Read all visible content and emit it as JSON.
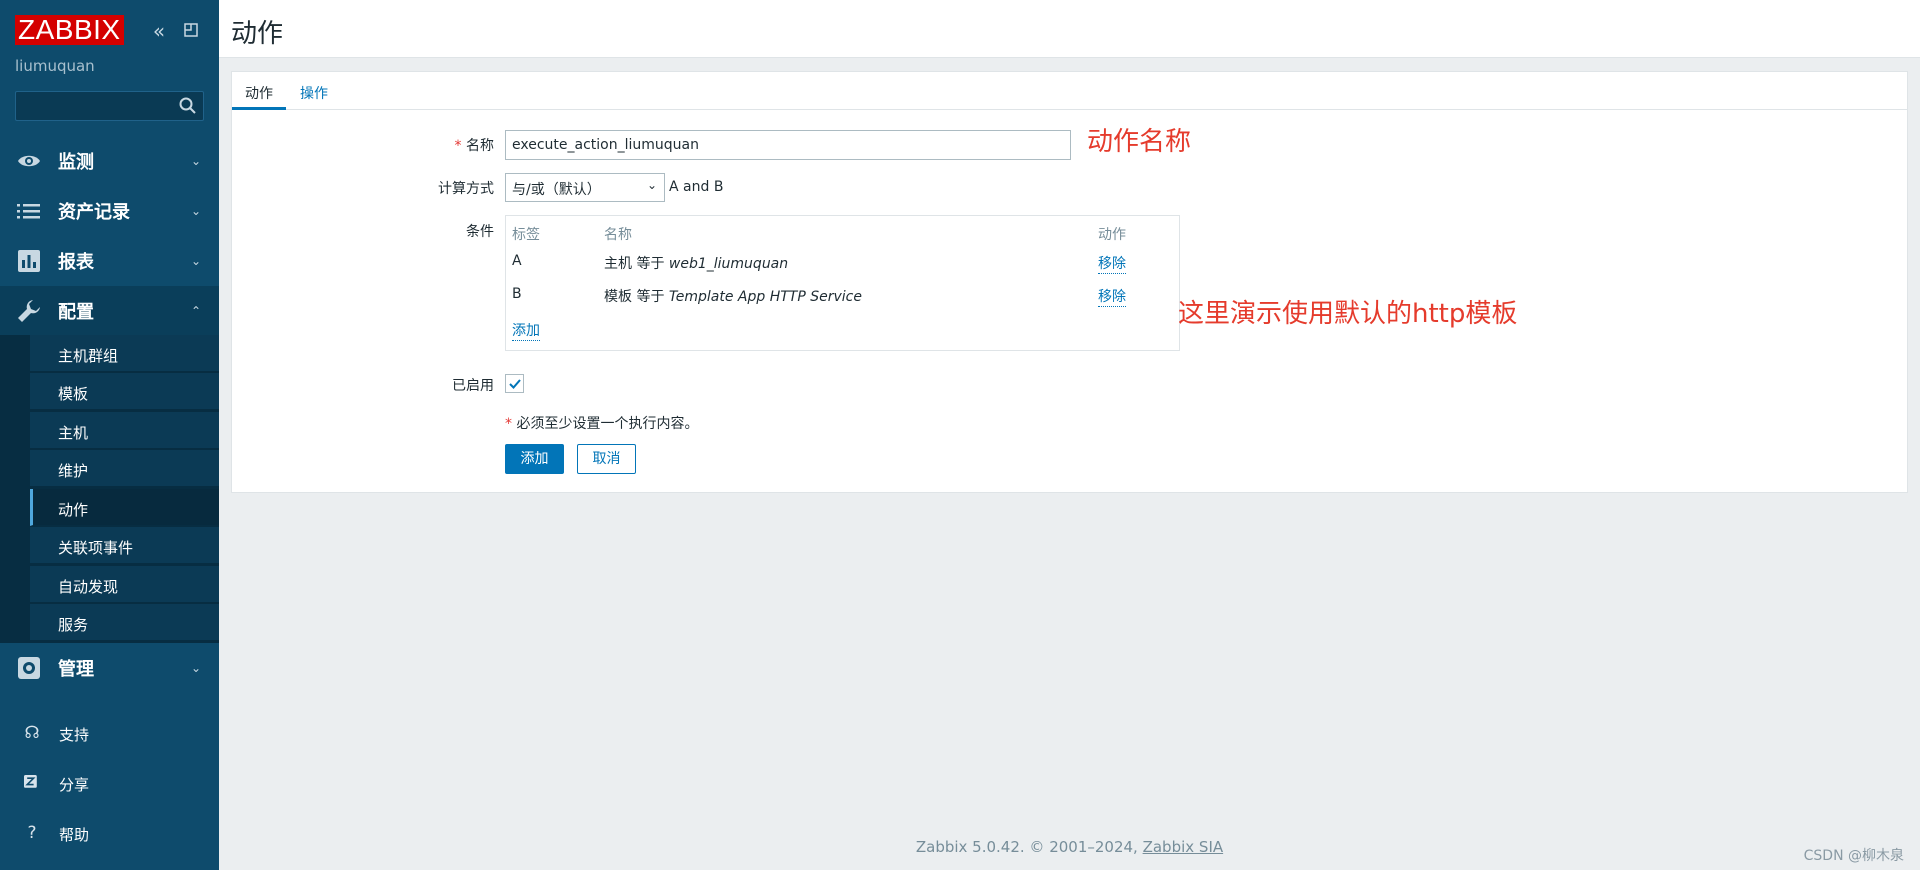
{
  "sidebar": {
    "logo": "ZABBIX",
    "username": "liumuquan",
    "search_placeholder": "",
    "menu": [
      {
        "label": "监测",
        "icon": "eye-icon"
      },
      {
        "label": "资产记录",
        "icon": "list-icon"
      },
      {
        "label": "报表",
        "icon": "bar-chart-icon"
      },
      {
        "label": "配置",
        "icon": "wrench-icon"
      },
      {
        "label": "管理",
        "icon": "gear-icon"
      }
    ],
    "config_submenu": [
      "主机群组",
      "模板",
      "主机",
      "维护",
      "动作",
      "关联项事件",
      "自动发现",
      "服务"
    ],
    "bottom": [
      {
        "label": "支持",
        "icon": "headset-icon"
      },
      {
        "label": "分享",
        "icon": "share-icon"
      },
      {
        "label": "帮助",
        "icon": "help-icon"
      }
    ]
  },
  "header": {
    "title": "动作"
  },
  "tabs": [
    "动作",
    "操作"
  ],
  "form": {
    "name_label": "名称",
    "name_value": "execute_action_liumuquan",
    "calc_label": "计算方式",
    "calc_value": "与/或（默认）",
    "calc_formula": "A and B",
    "conditions_label": "条件",
    "conditions_headers": {
      "tag": "标签",
      "name": "名称",
      "action": "动作"
    },
    "conditions": [
      {
        "tag": "A",
        "prefix": "主机 等于 ",
        "value": "web1_liumuquan",
        "action": "移除"
      },
      {
        "tag": "B",
        "prefix": "模板 等于 ",
        "value": "Template App HTTP Service",
        "action": "移除"
      }
    ],
    "add_condition": "添加",
    "enabled_label": "已启用",
    "enabled": true,
    "note": "必须至少设置一个执行内容。",
    "add_button": "添加",
    "cancel_button": "取消"
  },
  "annotations": {
    "name_note": "动作名称",
    "template_note": "这里演示使用默认的http模板"
  },
  "footer": {
    "text": "Zabbix 5.0.42. © 2001–2024,",
    "link": "Zabbix SIA"
  },
  "watermark": "CSDN @柳木泉",
  "colors": {
    "sidebar": "#0e4b6c",
    "accent": "#0275b8",
    "logo": "#d40000",
    "annotation": "#e53b2c"
  }
}
